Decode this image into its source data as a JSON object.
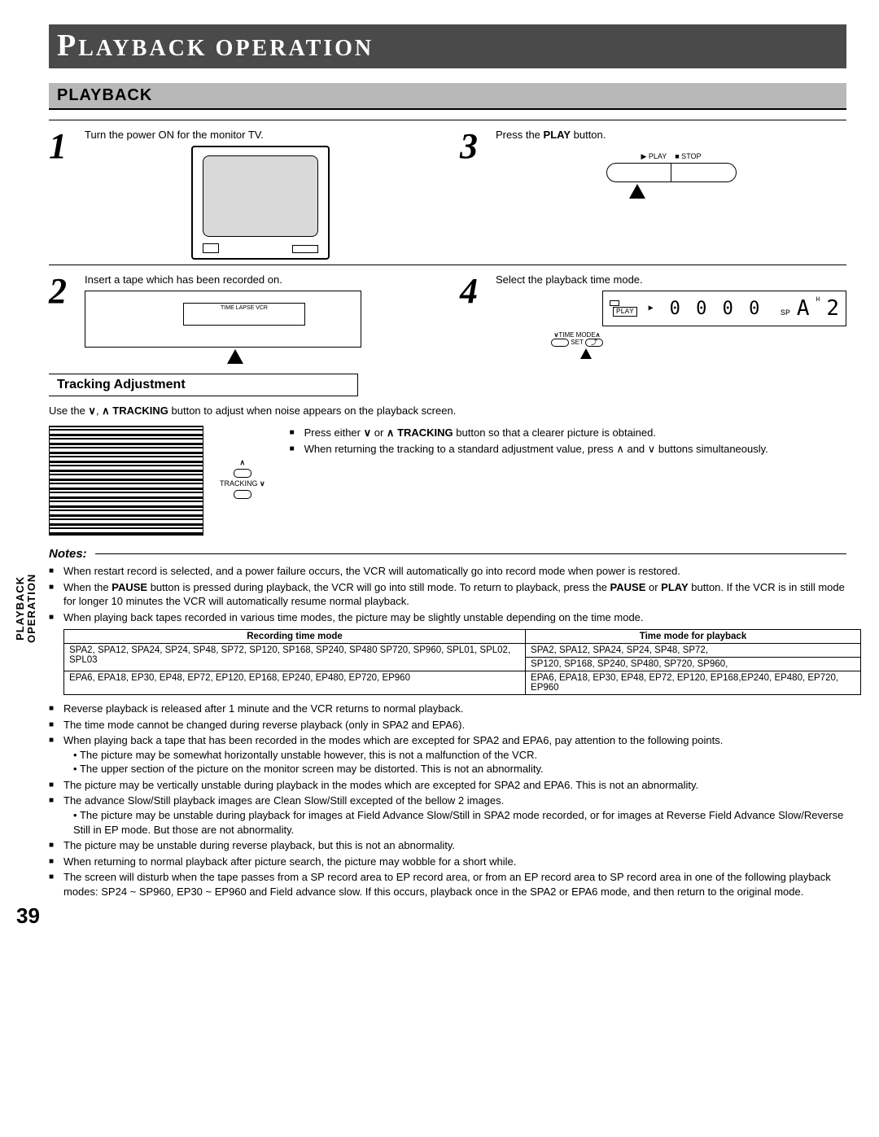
{
  "chapter_title_prefix": "P",
  "chapter_title_rest": "LAYBACK OPERATION",
  "section_title": "PLAYBACK",
  "side_tab": "PLAYBACK\nOPERATION",
  "page_number": "39",
  "steps": {
    "s1_text": "Turn the power ON for the monitor TV.",
    "s2_text": "Insert a tape which has been recorded on.",
    "s3_pre": "Press the ",
    "s3_bold": "PLAY",
    "s3_post": " button.",
    "s4_text": "Select the playback time mode.",
    "vcr_label": "TIME LAPSE VCR",
    "play_label": "▶ PLAY",
    "stop_label": "■ STOP",
    "lcd_play": "PLAY",
    "lcd_digits": "0 0 0 0",
    "lcd_sp": "SP",
    "lcd_a": "A",
    "lcd_h": "H",
    "lcd_2": "2",
    "timemode_label": "TIME MODE",
    "set_label": "SET"
  },
  "tracking": {
    "header": "Tracking Adjustment",
    "intro_pre": "Use the ",
    "intro_mid": " TRACKING",
    "intro_post": " button to adjust when noise appears on the playback screen.",
    "btn_label": "TRACKING",
    "b1_pre": "Press either ",
    "b1_mid": "TRACKING",
    "b1_post": " button so that a clearer picture is obtained.",
    "b2": "When returning the tracking to a standard adjustment value, press ∧ and ∨ buttons simultaneously."
  },
  "notes": {
    "header": "Notes:",
    "n1": "When restart record is selected, and a power failure occurs, the VCR will automatically go into record mode when power is restored.",
    "n2_pre": "When the ",
    "n2_b1": "PAUSE",
    "n2_mid": " button is pressed during playback, the VCR will go into still mode. To return to playback, press the ",
    "n2_b2": "PAUSE",
    "n2_mid2": " or ",
    "n2_b3": "PLAY",
    "n2_post": " button. If the VCR is in still mode for longer 10 minutes the VCR will automatically resume normal playback.",
    "n3": "When playing back tapes recorded in various time modes, the picture may be slightly unstable depending on the time mode.",
    "table": {
      "h1": "Recording time mode",
      "h2": "Time mode for playback",
      "r1c1": "SPA2, SPA12, SPA24, SP24, SP48, SP72, SP120, SP168, SP240, SP480 SP720, SP960, SPL01, SPL02, SPL03",
      "r1c2a": "SPA2, SPA12, SPA24, SP24, SP48, SP72,",
      "r1c2b": "SP120, SP168, SP240, SP480, SP720, SP960,",
      "r2c1": "EPA6, EPA18, EP30, EP48, EP72, EP120, EP168, EP240, EP480, EP720, EP960",
      "r2c2": "EPA6, EPA18, EP30, EP48, EP72, EP120, EP168,EP240, EP480, EP720, EP960"
    },
    "n4": "Reverse playback is released after 1 minute and the VCR returns to normal playback.",
    "n5": "The time mode cannot be changed during reverse playback (only in SPA2 and EPA6).",
    "n6": "When playing back a tape that has been recorded in the modes which are excepted for SPA2 and EPA6, pay attention to the following points.",
    "n6a": "The picture may be somewhat horizontally unstable however, this is not a malfunction of the VCR.",
    "n6b": "The upper section of the picture on the monitor screen may be distorted. This is not an abnormality.",
    "n7": "The picture may be vertically unstable during playback in the modes which are excepted for SPA2 and EPA6. This is not an abnormality.",
    "n8": "The advance Slow/Still playback images are Clean Slow/Still excepted of the bellow 2 images.",
    "n8a": "The picture may be unstable during playback for images at Field Advance Slow/Still in SPA2 mode recorded, or for images at Reverse Field Advance Slow/Reverse Still in EP mode. But those are not abnormality.",
    "n9": "The picture may be unstable during reverse playback, but this is not an abnormality.",
    "n10": "When returning to normal playback after picture search, the picture may wobble for a short while.",
    "n11": "The screen will disturb when the tape passes from a SP record area to EP record area, or from an EP record area to SP record area in one of the following playback modes: SP24 ~ SP960, EP30 ~ EP960 and Field advance slow. If this occurs, playback once in the SPA2 or EPA6 mode, and then return to the original mode."
  }
}
